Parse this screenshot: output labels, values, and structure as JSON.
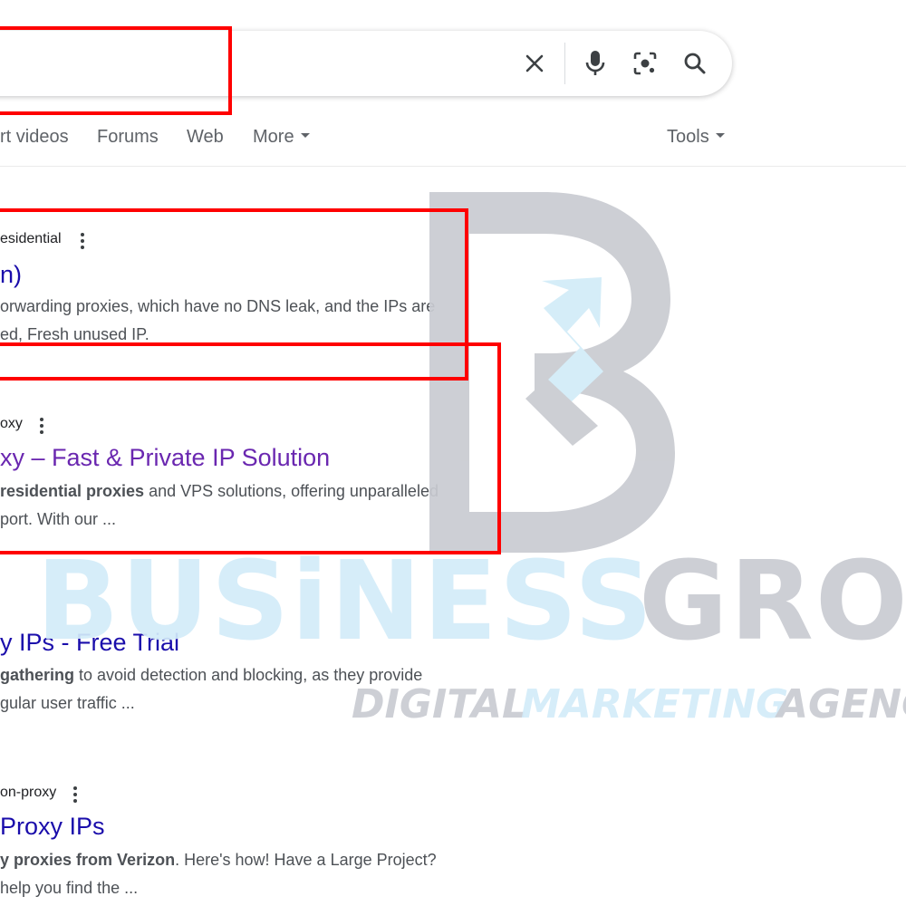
{
  "search": {
    "query": "",
    "clear_icon": "close-icon",
    "voice_icon": "microphone-icon",
    "lens_icon": "camera-lens-icon",
    "search_icon": "search-icon"
  },
  "tabs": {
    "short_videos": "rt videos",
    "forums": "Forums",
    "web": "Web",
    "more": "More",
    "tools": "Tools"
  },
  "results": [
    {
      "site": "esidential",
      "title": "n)",
      "snippet_line1": "orwarding proxies, which have no DNS leak, and the IPs are",
      "snippet_line2": "ed, Fresh unused IP."
    },
    {
      "site": "oxy",
      "title": "xy – Fast & Private IP Solution",
      "snippet_bold": "residential proxies",
      "snippet_rest": " and VPS solutions, offering unparalleled",
      "snippet_line2": "port. With our ..."
    },
    {
      "title": "y IPs - Free Trial",
      "snippet_bold": "gathering",
      "snippet_rest": " to avoid detection and blocking, as they provide",
      "snippet_line2": "gular user traffic ..."
    },
    {
      "site": "on-proxy",
      "title": "Proxy IPs",
      "snippet_bold": "y proxies from Verizon",
      "snippet_rest": ". Here's how! Have a Large Project?",
      "snippet_line2": "help you find the ..."
    }
  ],
  "watermark": {
    "word1": "BUSiNESS",
    "word2": "GROw",
    "tagline1": "DIGITAL",
    "tagline2": "MARKETING",
    "tagline3": "AGENC",
    "colors": {
      "gray": "#c9cbd1",
      "blue": "#d2ecf8"
    }
  },
  "annotation_color": "#ff0000"
}
